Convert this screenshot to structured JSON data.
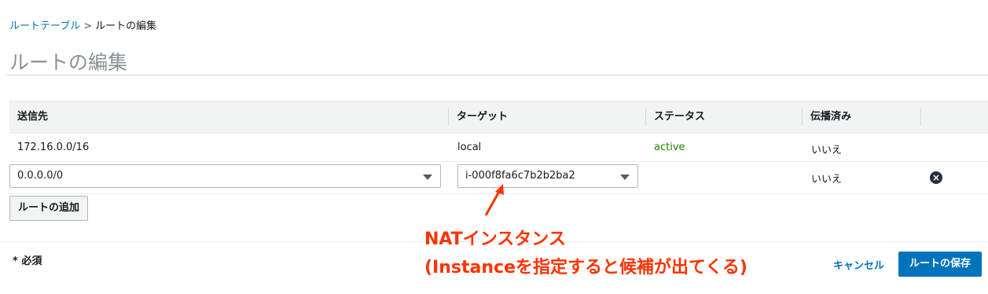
{
  "breadcrumb": {
    "parent": "ルートテーブル",
    "separator": ">",
    "current": "ルートの編集"
  },
  "page": {
    "title": "ルートの編集"
  },
  "table": {
    "headers": [
      "送信先",
      "ターゲット",
      "ステータス",
      "伝播済み"
    ],
    "rows": [
      {
        "destination": "172.16.0.0/16",
        "target": "local",
        "status": "active",
        "propagated": "いいえ"
      },
      {
        "destination": "0.0.0.0/0",
        "target": "i-000f8fa6c7b2b2ba2",
        "status": "",
        "propagated": "いいえ",
        "remove_icon": "close-circle-icon"
      }
    ]
  },
  "buttons": {
    "add_route": "ルートの追加",
    "cancel": "キャンセル",
    "save": "ルートの保存"
  },
  "footer": {
    "required": "* 必須"
  },
  "annotation": {
    "line1": "NATインスタンス",
    "line2": "(Instanceを指定すると候補が出てくる)",
    "color": "#ff3300"
  },
  "colors": {
    "link": "#0073bb",
    "primary_button": "#0073bb",
    "status_active": "#1d8102"
  }
}
